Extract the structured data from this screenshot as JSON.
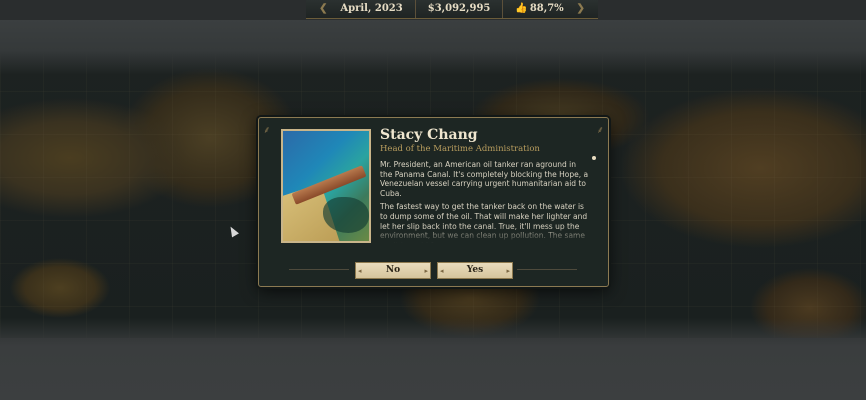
{
  "hud": {
    "date": "April, 2023",
    "budget": "$3,092,995",
    "approval": "88,7%",
    "approval_icon": "thumbs-up-icon"
  },
  "dialog": {
    "speaker_name": "Stacy Chang",
    "speaker_role": "Head of the Maritime Administration",
    "paragraphs": [
      "Mr. President, an American oil tanker ran aground in the Panama Canal. It's completely blocking the Hope, a Venezuelan vessel carrying urgent humanitarian aid to Cuba.",
      "The fastest way to get the tanker back on the water is to dump some of the oil. That will make her lighter and let her slip back into the canal. True, it'll mess up the environment, but we can clean up pollution. The same can't be said for"
    ],
    "no_label": "No",
    "yes_label": "Yes",
    "portrait_icon": "oil-tanker-aground-portrait"
  },
  "colors": {
    "accent_gold": "#8c7a52",
    "dialog_bg": "#1d2623",
    "button_bg": "#e0d1ac"
  }
}
